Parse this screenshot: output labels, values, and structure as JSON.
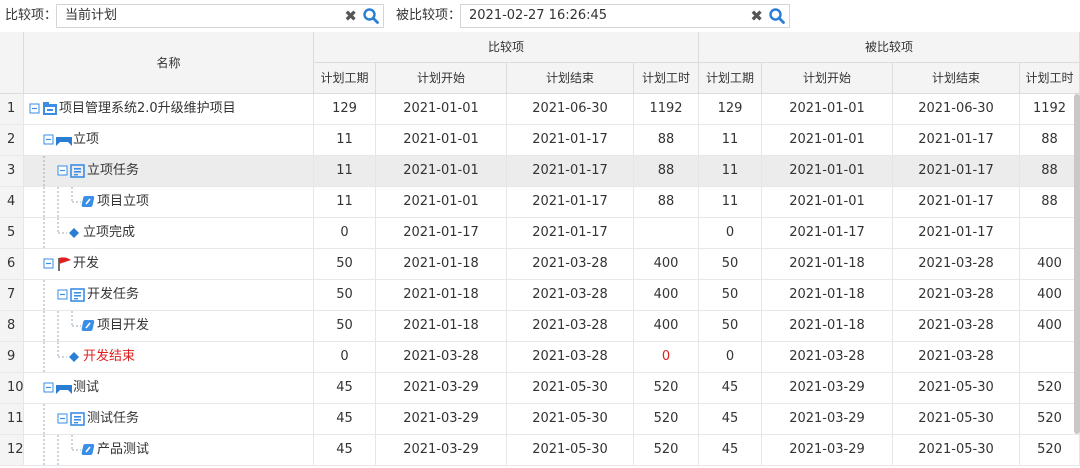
{
  "toolbar": {
    "compare_label": "比较项：",
    "compare_value": "当前计划",
    "compared_label": "被比较项：",
    "compared_value": "2021-02-27 16:26:45",
    "clear_glyph": "✖"
  },
  "header": {
    "name": "名称",
    "group_compare": "比较项",
    "group_compared": "被比较项",
    "columns": [
      "计划工期",
      "计划开始",
      "计划结束",
      "计划工时",
      "计划工期",
      "计划开始",
      "计划结束",
      "计划工时"
    ]
  },
  "colors": {
    "accent": "#2a7fd4",
    "danger": "#e02020",
    "selected_row": "#ececec"
  },
  "rows": [
    {
      "num": "1",
      "name": "项目管理系统2.0升级维护项目",
      "level": 0,
      "icon": "project-icon",
      "a": [
        "129",
        "2021-01-01",
        "2021-06-30",
        "1192"
      ],
      "b": [
        "129",
        "2021-01-01",
        "2021-06-30",
        "1192"
      ]
    },
    {
      "num": "2",
      "name": "立项",
      "level": 1,
      "icon": "phase-icon",
      "a": [
        "11",
        "2021-01-01",
        "2021-01-17",
        "88"
      ],
      "b": [
        "11",
        "2021-01-01",
        "2021-01-17",
        "88"
      ]
    },
    {
      "num": "3",
      "name": "立项任务",
      "level": 2,
      "icon": "task-group-icon",
      "a": [
        "11",
        "2021-01-01",
        "2021-01-17",
        "88"
      ],
      "b": [
        "11",
        "2021-01-01",
        "2021-01-17",
        "88"
      ],
      "selected": true
    },
    {
      "num": "4",
      "name": "项目立项",
      "level": 3,
      "icon": "task-icon",
      "a": [
        "11",
        "2021-01-01",
        "2021-01-17",
        "88"
      ],
      "b": [
        "11",
        "2021-01-01",
        "2021-01-17",
        "88"
      ]
    },
    {
      "num": "5",
      "name": "立项完成",
      "level": 2,
      "icon": "milestone-icon",
      "a": [
        "0",
        "2021-01-17",
        "2021-01-17",
        ""
      ],
      "b": [
        "0",
        "2021-01-17",
        "2021-01-17",
        ""
      ]
    },
    {
      "num": "6",
      "name": "开发",
      "level": 1,
      "icon": "flag-icon",
      "a": [
        "50",
        "2021-01-18",
        "2021-03-28",
        "400"
      ],
      "b": [
        "50",
        "2021-01-18",
        "2021-03-28",
        "400"
      ]
    },
    {
      "num": "7",
      "name": "开发任务",
      "level": 2,
      "icon": "task-group-icon",
      "a": [
        "50",
        "2021-01-18",
        "2021-03-28",
        "400"
      ],
      "b": [
        "50",
        "2021-01-18",
        "2021-03-28",
        "400"
      ]
    },
    {
      "num": "8",
      "name": "项目开发",
      "level": 3,
      "icon": "task-icon",
      "a": [
        "50",
        "2021-01-18",
        "2021-03-28",
        "400"
      ],
      "b": [
        "50",
        "2021-01-18",
        "2021-03-28",
        "400"
      ]
    },
    {
      "num": "9",
      "name": "开发结束",
      "level": 2,
      "icon": "milestone-icon",
      "a": [
        "0",
        "2021-03-28",
        "2021-03-28",
        "0"
      ],
      "b": [
        "0",
        "2021-03-28",
        "2021-03-28",
        ""
      ],
      "red_name": true,
      "red_hours": true
    },
    {
      "num": "10",
      "name": "测试",
      "level": 1,
      "icon": "phase-icon",
      "a": [
        "45",
        "2021-03-29",
        "2021-05-30",
        "520"
      ],
      "b": [
        "45",
        "2021-03-29",
        "2021-05-30",
        "520"
      ]
    },
    {
      "num": "11",
      "name": "测试任务",
      "level": 2,
      "icon": "task-group-icon",
      "a": [
        "45",
        "2021-03-29",
        "2021-05-30",
        "520"
      ],
      "b": [
        "45",
        "2021-03-29",
        "2021-05-30",
        "520"
      ]
    },
    {
      "num": "12",
      "name": "产品测试",
      "level": 3,
      "icon": "task-icon",
      "a": [
        "45",
        "2021-03-29",
        "2021-05-30",
        "520"
      ],
      "b": [
        "45",
        "2021-03-29",
        "2021-05-30",
        "520"
      ]
    }
  ]
}
